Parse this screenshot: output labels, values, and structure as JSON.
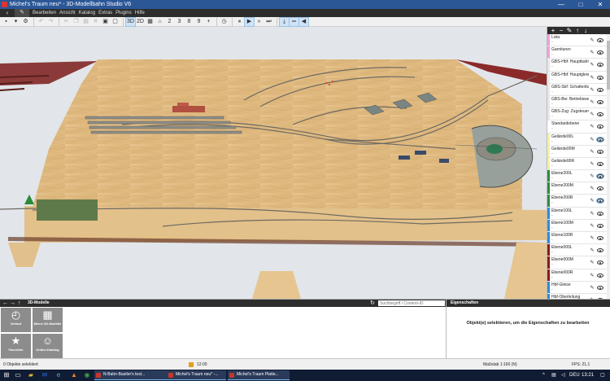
{
  "window": {
    "title": "Michel's Traum neu* - 3D-Modellbahn Studio V6",
    "min": "—",
    "max": "□",
    "close": "✕"
  },
  "menu": {
    "items": [
      "Bearbeiten",
      "Ansicht",
      "Katalog",
      "Extras",
      "Plugins",
      "Hilfe"
    ]
  },
  "toolbar": {
    "view3d": "3D",
    "view2d": "2D",
    "counts": [
      "2",
      "3",
      "8",
      "9"
    ]
  },
  "layers": [
    {
      "name": "Loks",
      "sub": "-",
      "color": "#f0a0d8",
      "eye_hl": false
    },
    {
      "name": "Garnituren",
      "sub": "-",
      "color": "#f0a0d8",
      "eye_hl": false
    },
    {
      "name": "GBS-Hbf: Hauptbahnhof",
      "sub": "-",
      "color": "#e8e8e8",
      "eye_hl": false
    },
    {
      "name": "GBS-Hbf: Hauptgleise",
      "sub": "-",
      "color": "#e8e8e8",
      "eye_hl": false
    },
    {
      "name": "GBS-Sbf: Schattenbahnhof",
      "sub": "-",
      "color": "#e8e8e8",
      "eye_hl": false
    },
    {
      "name": "GBS-Bw: Betriebswerk",
      "sub": "-",
      "color": "#e8e8e8",
      "eye_hl": false
    },
    {
      "name": "GBS-Zug: Zugsteuerung",
      "sub": "-",
      "color": "#e8e8e8",
      "eye_hl": false
    },
    {
      "name": "Standardebene",
      "sub": "-",
      "color": "#ffffff",
      "eye_hl": false
    },
    {
      "name": "Gelände00L",
      "sub": "-",
      "color": "#f5f3a0",
      "eye_hl": true
    },
    {
      "name": "Gelände00M",
      "sub": "-",
      "color": "#f5f3a0",
      "eye_hl": false
    },
    {
      "name": "Gelände00R",
      "sub": "-",
      "color": "#f5f3a0",
      "eye_hl": false
    },
    {
      "name": "Ebene200L",
      "sub": "-",
      "color": "#2e8b3e",
      "eye_hl": true
    },
    {
      "name": "Ebene200M",
      "sub": "-",
      "color": "#2e8b3e",
      "eye_hl": false
    },
    {
      "name": "Ebene200R",
      "sub": "-",
      "color": "#2e8b3e",
      "eye_hl": true
    },
    {
      "name": "Ebene100L",
      "sub": "-",
      "color": "#2e8bd8",
      "eye_hl": false
    },
    {
      "name": "Ebene100M",
      "sub": "-",
      "color": "#2e8bd8",
      "eye_hl": false
    },
    {
      "name": "Ebene100R",
      "sub": "-",
      "color": "#2e8bd8",
      "eye_hl": false
    },
    {
      "name": "Ebene000L",
      "sub": "-",
      "color": "#8b1a1a",
      "eye_hl": false
    },
    {
      "name": "Ebene000M",
      "sub": "-",
      "color": "#8b1a1a",
      "eye_hl": false
    },
    {
      "name": "Ebene000R",
      "sub": "-",
      "color": "#8b1a1a",
      "eye_hl": false
    },
    {
      "name": "Hbf-Gleise",
      "sub": "-",
      "color": "#2e8bd8",
      "eye_hl": false
    },
    {
      "name": "Hbf-Oberleitung",
      "sub": "-",
      "color": "#2e8bd8",
      "eye_hl": false
    }
  ],
  "models_panel": {
    "title": "3D-Modelle",
    "search_placeholder": "Suchbegriff / Content-ID",
    "tiles": [
      {
        "label": "Verlauf",
        "icon": "clock-icon",
        "glyph": "◴"
      },
      {
        "label": "Meine 3D-Modelle",
        "icon": "grid-icon",
        "glyph": "▦"
      },
      {
        "label": "Favoriten",
        "icon": "star-icon",
        "glyph": "★"
      },
      {
        "label": "Online-Katalog",
        "icon": "users-icon",
        "glyph": "☺"
      }
    ]
  },
  "props_panel": {
    "title": "Eigenschaften",
    "message": "Objekt(e) selektieren, um die Eigenschaften zu bearbeiten"
  },
  "status": {
    "selection": "0 Objekte selektiert",
    "time": "12:00",
    "scale": "Maßstab 1:160 (N)",
    "fps": "FPS: 21,1"
  },
  "taskbar": {
    "tasks": [
      "N-Bahn-Bastler's test...",
      "Michel's Traum neu* -...",
      "Michel's Traum Platte..."
    ],
    "tray": {
      "lang": "DEU",
      "time": "13:21"
    }
  }
}
